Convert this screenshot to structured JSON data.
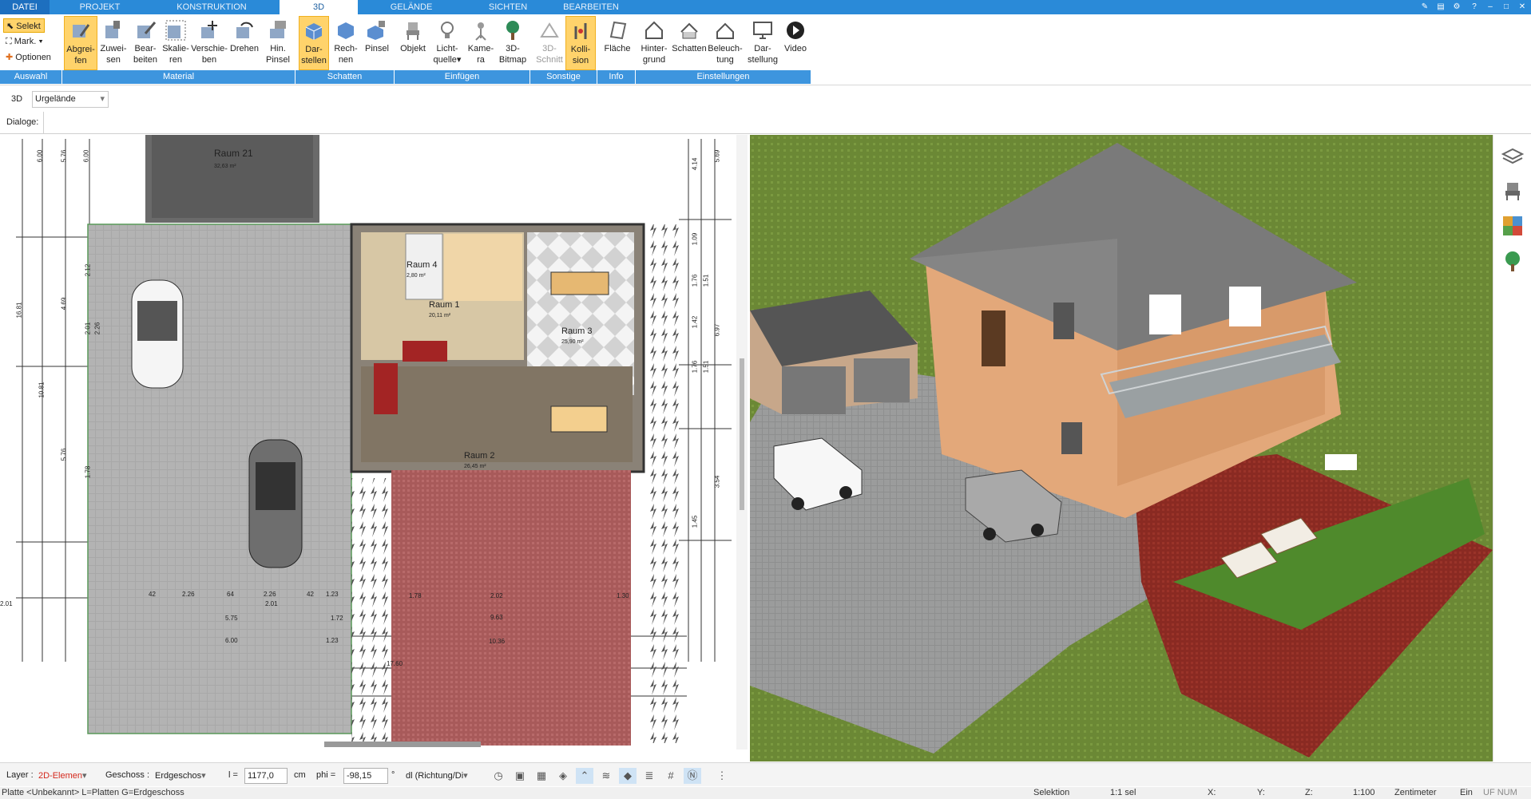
{
  "tabs": [
    "DATEI",
    "PROJEKT",
    "KONSTRUKTION",
    "3D",
    "GELÄNDE",
    "SICHTEN",
    "BEARBEITEN"
  ],
  "ribbon": {
    "auswahl": {
      "select": "Selekt",
      "mark": "Mark.",
      "options": "Optionen"
    },
    "buttons": [
      {
        "line1": "Abgrei-",
        "line2": "fen"
      },
      {
        "line1": "Zuwei-",
        "line2": "sen"
      },
      {
        "line1": "Bear-",
        "line2": "beiten"
      },
      {
        "line1": "Skalie-",
        "line2": "ren"
      },
      {
        "line1": "Verschie-",
        "line2": "ben"
      },
      {
        "line1": "Drehen",
        "line2": ""
      },
      {
        "line1": "Hin.",
        "line2": "Pinsel"
      },
      {
        "line1": "Dar-",
        "line2": "stellen"
      },
      {
        "line1": "Rech-",
        "line2": "nen"
      },
      {
        "line1": "Pinsel",
        "line2": ""
      },
      {
        "line1": "Objekt",
        "line2": ""
      },
      {
        "line1": "Licht-",
        "line2": "quelle"
      },
      {
        "line1": "Kame-",
        "line2": "ra"
      },
      {
        "line1": "3D-",
        "line2": "Bitmap"
      },
      {
        "line1": "3D-",
        "line2": "Schnitt"
      },
      {
        "line1": "Kolli-",
        "line2": "sion"
      },
      {
        "line1": "Fläche",
        "line2": ""
      },
      {
        "line1": "Hinter-",
        "line2": "grund"
      },
      {
        "line1": "Schatten",
        "line2": ""
      },
      {
        "line1": "Beleuch-",
        "line2": "tung"
      },
      {
        "line1": "Dar-",
        "line2": "stellung"
      },
      {
        "line1": "Video",
        "line2": ""
      }
    ],
    "groups": [
      "Auswahl",
      "Material",
      "Schatten",
      "Einfügen",
      "Sonstige",
      "Info",
      "Einstellungen"
    ]
  },
  "toolbar3d": {
    "mode": "3D",
    "level": "Urgelände"
  },
  "dialogs": {
    "label": "Dialoge:"
  },
  "plan": {
    "rooms": [
      {
        "name": "Raum 21",
        "area": "32,63 m²"
      },
      {
        "name": "Raum 4",
        "area": "2,80 m²"
      },
      {
        "name": "Raum 1",
        "area": "20,11 m²"
      },
      {
        "name": "Raum 3",
        "area": "25,90 m²"
      },
      {
        "name": "Raum 2",
        "area": "26,45 m²"
      }
    ],
    "dims_left": [
      "6.00",
      "5.76",
      "6.00",
      "16.81",
      "10.81",
      "4.69",
      "2.12",
      "2.01",
      "2.26",
      "5.76",
      "1.78"
    ],
    "dims_right": [
      "5.69",
      "4.14",
      "1.09",
      "1.76",
      "1.51",
      "1.42",
      "6.97",
      "1.76",
      "1.51",
      "3.54",
      "1.45"
    ],
    "dims_bottom": [
      "42",
      "2.26",
      "64",
      "2.26",
      "42",
      "1.23",
      "2.01",
      "2.01",
      "5.75",
      "1.72",
      "6.00",
      "1.23",
      "1.78",
      "2.02",
      "1.30",
      "9.63",
      "10.36",
      "17.60"
    ]
  },
  "bottombar": {
    "layer_label": "Layer :",
    "layer_value": "2D-Elemen",
    "geschoss_label": "Geschoss :",
    "geschoss_value": "Erdgeschos",
    "l_label": "l =",
    "l_value": "1177,0",
    "l_unit": "cm",
    "phi_label": "phi =",
    "phi_value": "-98,15",
    "phi_unit": "°",
    "dl_value": "dl (Richtung/Di"
  },
  "statusbar": {
    "left": "Platte <Unbekannt> L=Platten G=Erdgeschoss",
    "mode": "Selektion",
    "sel": "1:1 sel",
    "x": "X:",
    "y": "Y:",
    "z": "Z:",
    "scale": "1:100",
    "unit": "Zentimeter",
    "ein": "Ein",
    "flags": "UF NUM RF"
  },
  "colors": {
    "ribbon_blue": "#2a8ad8",
    "group_blue": "#3d95de",
    "active_yellow": "#ffd36b",
    "layer_red": "#d4281c"
  }
}
